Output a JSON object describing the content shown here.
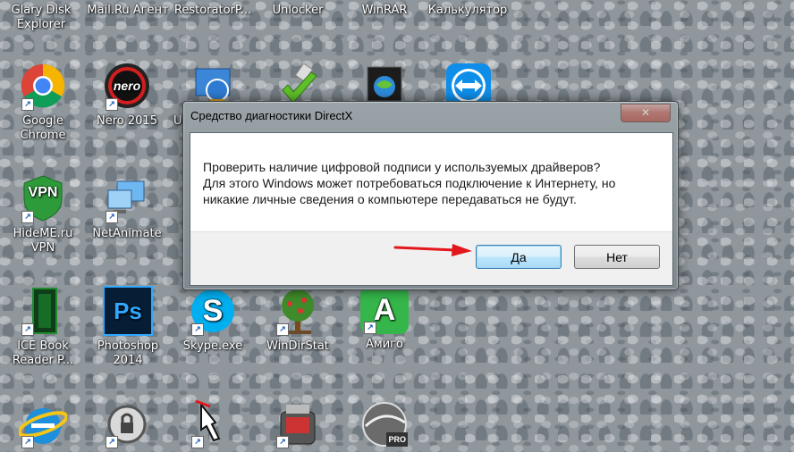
{
  "desktop": {
    "icons": [
      {
        "label": "Glary Disk\nExplorer"
      },
      {
        "label": "Mail.Ru Агент"
      },
      {
        "label": "RestoratorP..."
      },
      {
        "label": "Unlocker"
      },
      {
        "label": "WinRAR"
      },
      {
        "label": "Калькулятор"
      },
      {
        "label": "Google\nChrome"
      },
      {
        "label": "Nero 2015"
      },
      {
        "label": "U"
      },
      {
        "label": "HideME.ru VPN"
      },
      {
        "label": "NetAnimate"
      },
      {
        "label": "ICE Book\nReader P..."
      },
      {
        "label": "Photoshop\n2014"
      },
      {
        "label": "Skype.exe"
      },
      {
        "label": "WinDirStat"
      },
      {
        "label": "Амиго"
      }
    ],
    "glyphs": {
      "nero": "nero",
      "vpn": "VPN",
      "ps": "Ps",
      "skype": "S",
      "amigo": "A",
      "pro": "PRO",
      "shortcut": "↗"
    }
  },
  "dialog": {
    "title": "Средство диагностики DirectX",
    "close": "✕",
    "message_lines": [
      "Проверить наличие цифровой подписи у используемых драйверов?",
      "Для этого Windows может потребоваться подключение к Интернету, но",
      "никакие личные сведения о компьютере передаваться не будут."
    ],
    "yes_label": "Да",
    "no_label": "Нет"
  },
  "colors": {
    "accent_red": "#e3161b",
    "yes_border": "#3c7fb1"
  }
}
